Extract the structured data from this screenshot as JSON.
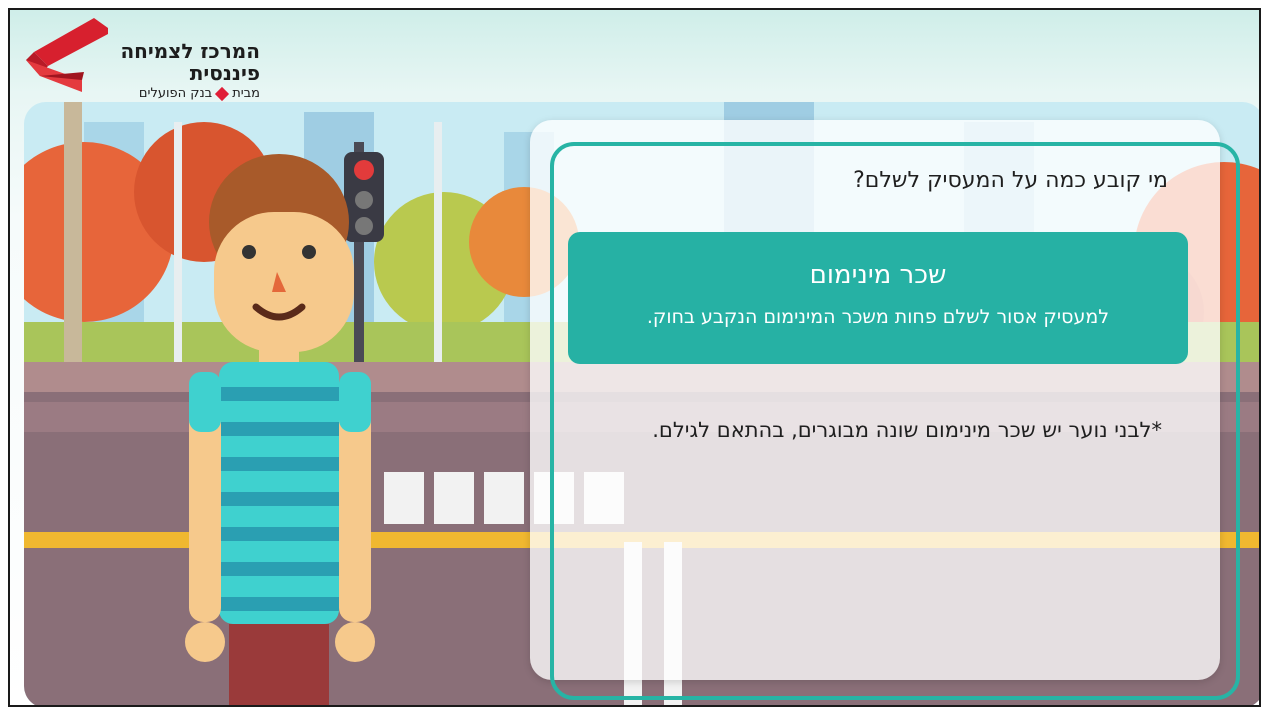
{
  "logo": {
    "title": "המרכז לצמיחה פיננסית",
    "subtitle_left": "מבית",
    "subtitle_right": "בנק הפועלים"
  },
  "card": {
    "question": "מי קובע כמה על המעסיק לשלם?",
    "answer_title": "שכר מינימום",
    "answer_body": "למעסיק אסור לשלם פחות משכר המינימום הנקבע בחוק.",
    "note": "*לבני נוער יש שכר מינימום שונה מבוגרים, בהתאם לגילם."
  },
  "colors": {
    "accent": "#26b1a4",
    "brand_red": "#e01e37"
  }
}
